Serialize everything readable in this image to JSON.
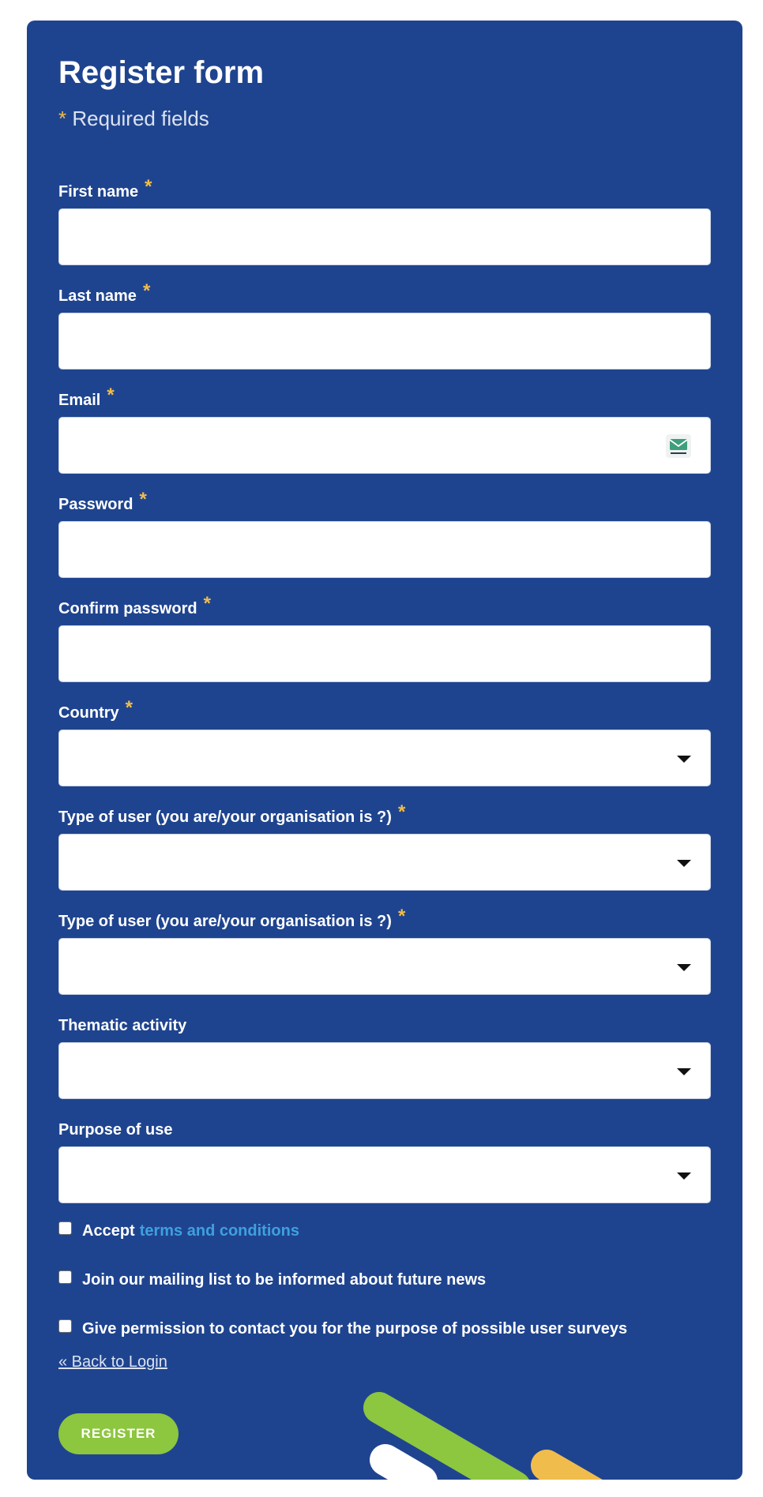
{
  "form": {
    "title": "Register form",
    "required_note": "Required fields",
    "required_mark": "*"
  },
  "fields": [
    {
      "label": "First name",
      "required": true,
      "type": "text",
      "value": ""
    },
    {
      "label": "Last name",
      "required": true,
      "type": "text",
      "value": ""
    },
    {
      "label": "Email",
      "required": true,
      "type": "email",
      "value": ""
    },
    {
      "label": "Password",
      "required": true,
      "type": "password",
      "value": ""
    },
    {
      "label": "Confirm password",
      "required": true,
      "type": "password",
      "value": ""
    },
    {
      "label": "Country",
      "required": true,
      "type": "select",
      "value": ""
    },
    {
      "label": "Type of user (you are/your organisation is ?)",
      "required": true,
      "type": "select",
      "value": ""
    },
    {
      "label": "Type of user (you are/your organisation is ?)",
      "required": true,
      "type": "select",
      "value": ""
    },
    {
      "label": "Thematic activity",
      "required": false,
      "type": "select",
      "value": ""
    },
    {
      "label": "Purpose of use",
      "required": false,
      "type": "select",
      "value": ""
    }
  ],
  "checkboxes": {
    "terms": {
      "prefix": "Accept",
      "link_text": "terms and conditions",
      "checked": false
    },
    "mailing": {
      "label": "Join our mailing list to be informed about future news",
      "checked": false
    },
    "surveys": {
      "label": "Give permission to contact you for the purpose of possible user surveys",
      "checked": false
    }
  },
  "links": {
    "back_to_login": "« Back to Login"
  },
  "buttons": {
    "register": "REGISTER"
  },
  "icons": {
    "email_field_icon": "tempmail-envelope-icon",
    "select_caret": "caret-down-icon"
  },
  "colors": {
    "card_background": "#1f448f",
    "required_star": "#f0bd4c",
    "link": "#3fa0de",
    "register_button": "#8dc63f",
    "deco_green": "#8dc63f",
    "deco_yellow": "#f0bd4c"
  }
}
